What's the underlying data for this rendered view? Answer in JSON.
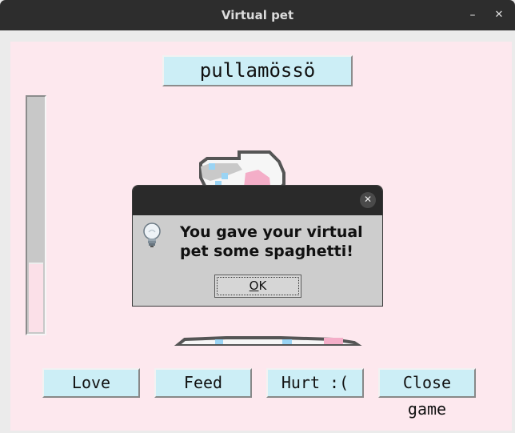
{
  "window": {
    "title": "Virtual pet",
    "minimize_glyph": "–",
    "close_glyph": "✕"
  },
  "pet": {
    "name": "pullamössö",
    "meter_level": 0.29
  },
  "buttons": {
    "love": "Love",
    "feed": "Feed",
    "hurt": "Hurt :(",
    "close": "Close game"
  },
  "dialog": {
    "close_glyph": "✕",
    "message": "You gave your virtual pet some spaghetti!",
    "ok_mnemonic": "O",
    "ok_rest": "K",
    "icon": "lightbulb-icon"
  },
  "colors": {
    "background": "#fde8ee",
    "button": "#cceef6",
    "meter_fill": "#fbe0e8",
    "titlebar": "#2d2d2d"
  }
}
